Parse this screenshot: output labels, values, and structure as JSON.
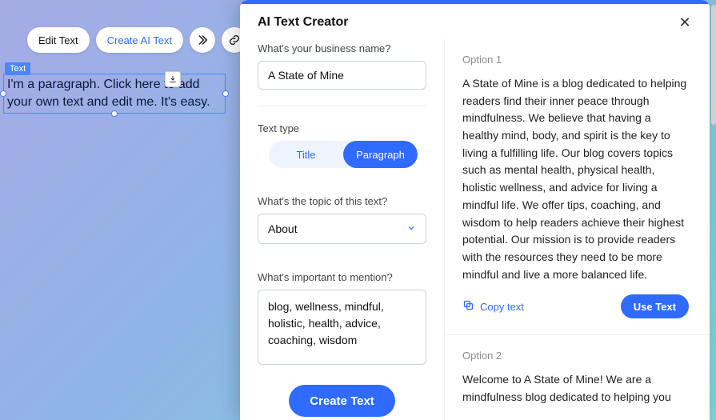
{
  "canvas": {
    "toolbar": {
      "edit_text": "Edit Text",
      "create_ai_text": "Create AI Text"
    },
    "text_element": {
      "badge": "Text",
      "content": "I'm a paragraph. Click here to add your own text and edit me. It's easy."
    }
  },
  "modal": {
    "title": "AI Text Creator",
    "close_label": "✕",
    "fields": {
      "business_name_label": "What's your business name?",
      "business_name_value": "A State of Mine",
      "text_type_label": "Text type",
      "text_type_options": {
        "title": "Title",
        "paragraph": "Paragraph"
      },
      "text_type_selected": "paragraph",
      "topic_label": "What's the topic of this text?",
      "topic_value": "About",
      "important_label": "What's important to mention?",
      "important_value": "blog, wellness, mindful, holistic, health, advice, coaching, wisdom",
      "create_button": "Create Text"
    },
    "results": {
      "copy_label": "Copy text",
      "use_label": "Use Text",
      "options": [
        {
          "label": "Option 1",
          "body": "A State of Mine is a blog dedicated to helping readers find their inner peace through mindfulness. We believe that having a healthy mind, body, and spirit is the key to living a fulfilling life. Our blog covers topics such as mental health, physical health, holistic wellness, and advice for living a mindful life. We offer tips, coaching, and wisdom to help readers achieve their highest potential. Our mission is to provide readers with the resources they need to be more mindful and live a more balanced life."
        },
        {
          "label": "Option 2",
          "body": "Welcome to A State of Mine! We are a mindfulness blog dedicated to helping you"
        }
      ]
    }
  }
}
